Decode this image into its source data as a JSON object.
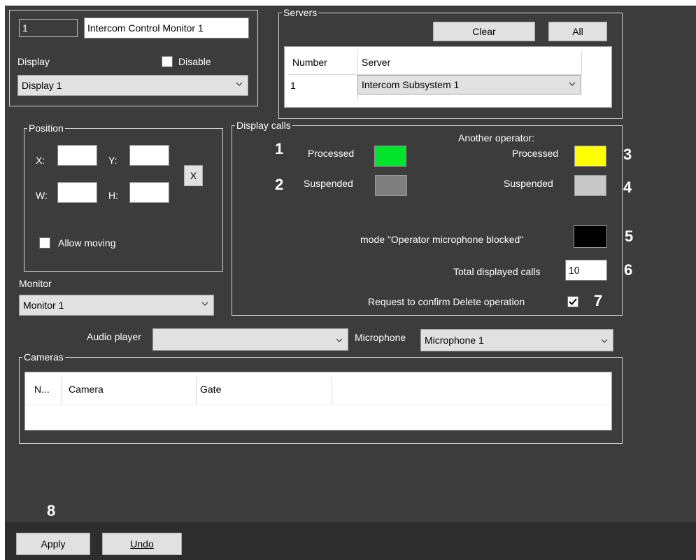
{
  "header": {
    "id_value": "1",
    "name_value": "Intercom Control Monitor 1",
    "display_label": "Display",
    "disable_label": "Disable",
    "display_select": "Display 1"
  },
  "servers": {
    "legend": "Servers",
    "clear_label": "Clear",
    "all_label": "All",
    "columns": [
      "Number",
      "Server"
    ],
    "rows": [
      {
        "number": "1",
        "server": "Intercom Subsystem 1"
      }
    ]
  },
  "position": {
    "legend": "Position",
    "x_label": "X:",
    "y_label": "Y:",
    "w_label": "W:",
    "h_label": "H:",
    "reset_label": "X",
    "allow_moving_label": "Allow moving"
  },
  "monitor": {
    "label": "Monitor",
    "value": "Monitor 1"
  },
  "display_calls": {
    "legend": "Display calls",
    "another_operator_label": "Another operator:",
    "processed_label": "Processed",
    "suspended_label": "Suspended",
    "other_processed_label": "Processed",
    "other_suspended_label": "Suspended",
    "mic_blocked_label": "mode \"Operator microphone blocked\"",
    "total_calls_label": "Total displayed calls",
    "total_calls_value": "10",
    "confirm_delete_label": "Request to confirm Delete operation",
    "confirm_delete_checked": true,
    "colors": {
      "processed": "#00e52b",
      "suspended": "#7f7f7f",
      "other_processed": "#ffff00",
      "other_suspended": "#c8c8c8",
      "mic_blocked": "#000000"
    }
  },
  "callouts": {
    "n1": "1",
    "n2": "2",
    "n3": "3",
    "n4": "4",
    "n5": "5",
    "n6": "6",
    "n7": "7",
    "n8": "8"
  },
  "audio": {
    "audio_player_label": "Audio player",
    "audio_player_value": "",
    "microphone_label": "Microphone",
    "microphone_value": "Microphone 1"
  },
  "cameras": {
    "legend": "Cameras",
    "columns": [
      "N...",
      "Camera",
      "Gate"
    ]
  },
  "footer": {
    "apply_label": "Apply",
    "undo_label": "Undo"
  }
}
